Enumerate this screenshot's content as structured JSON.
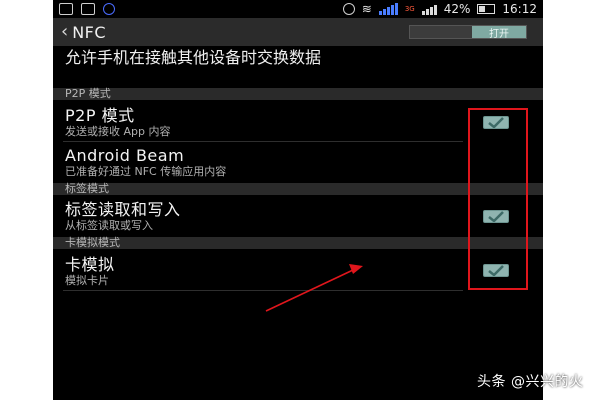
{
  "status_bar": {
    "signal_label": "3G",
    "battery": "42%",
    "time": "16:12"
  },
  "action_bar": {
    "title": "NFC",
    "toggle_label": "打开"
  },
  "intro_text": "允许手机在接触其他设备时交换数据",
  "sections": [
    {
      "header": "P2P 模式",
      "items": [
        {
          "title": "P2P 模式",
          "subtitle": "发送或接收 App 内容",
          "checked": true
        },
        {
          "title": "Android Beam",
          "subtitle": "已准备好通过 NFC 传输应用内容",
          "checked": false
        }
      ]
    },
    {
      "header": "标签模式",
      "items": [
        {
          "title": "标签读取和写入",
          "subtitle": "从标签读取或写入",
          "checked": true
        }
      ]
    },
    {
      "header": "卡模拟模式",
      "items": [
        {
          "title": "卡模拟",
          "subtitle": "模拟卡片",
          "checked": true
        }
      ]
    }
  ],
  "annotations": {
    "highlight_color": "#e0161c",
    "arrow_color": "#e0161c"
  },
  "watermark": "头条 @兴兴的火"
}
